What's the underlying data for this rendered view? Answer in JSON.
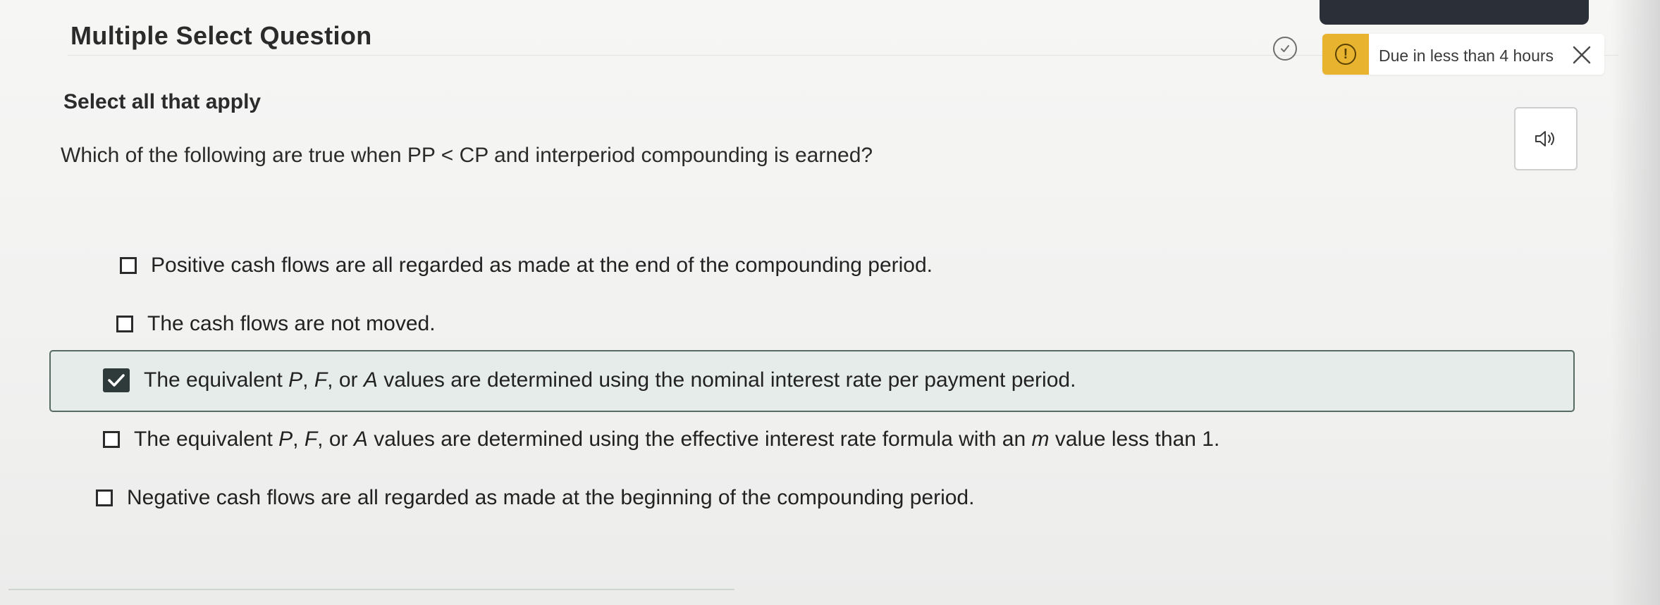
{
  "header": {
    "title": "Multiple Select Question",
    "instruction": "Select all that apply",
    "due_text": "Due in less than 4 hours",
    "alert_glyph": "!",
    "icons": {
      "progress": "check-circle-icon",
      "alert": "alert-icon",
      "close": "close-icon",
      "audio": "speaker-icon"
    }
  },
  "question": {
    "text": "Which of the following are true when PP < CP and interperiod compounding is earned?"
  },
  "options": [
    {
      "checked": false,
      "parts": [
        "Positive cash flows are all regarded as made at the end of the compounding period."
      ]
    },
    {
      "checked": false,
      "parts": [
        "The cash flows are not moved."
      ]
    },
    {
      "checked": true,
      "parts": [
        "The equivalent ",
        "P",
        ", ",
        "F",
        ", or ",
        "A",
        " values are determined using the nominal interest rate per payment period."
      ]
    },
    {
      "checked": false,
      "parts": [
        "The equivalent ",
        "P",
        ", ",
        "F",
        ", or ",
        "A",
        " values are determined using the effective interest rate formula with an ",
        "m",
        " value less than 1."
      ]
    },
    {
      "checked": false,
      "parts": [
        "Negative cash flows are all regarded as made at the beginning of the compounding period."
      ]
    }
  ],
  "colors": {
    "alert_yellow": "#e8b32e",
    "selected_bg": "#e5ece9",
    "selected_border": "#556b63",
    "checkbox_dark": "#2f3b3b"
  }
}
